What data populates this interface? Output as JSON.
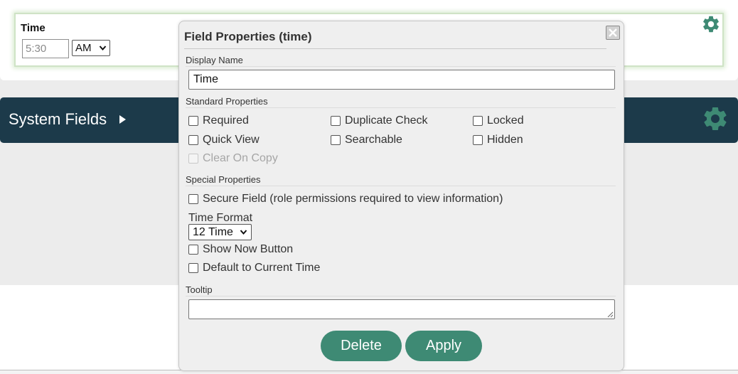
{
  "background": {
    "time_field": {
      "label": "Time",
      "value": "5:30",
      "ampm": "AM",
      "settings_icon": "gear-icon"
    },
    "system_fields": {
      "title": "System Fields",
      "expand_icon": "caret-right-icon",
      "settings_icon": "gear-icon"
    }
  },
  "dialog": {
    "title": "Field Properties (time)",
    "close_icon": "close-icon",
    "display_name": {
      "label": "Display Name",
      "value": "Time"
    },
    "standard_properties": {
      "label": "Standard Properties",
      "options": [
        {
          "label": "Required",
          "checked": false,
          "disabled": false
        },
        {
          "label": "Duplicate Check",
          "checked": false,
          "disabled": false
        },
        {
          "label": "Locked",
          "checked": false,
          "disabled": false
        },
        {
          "label": "Quick View",
          "checked": false,
          "disabled": false
        },
        {
          "label": "Searchable",
          "checked": false,
          "disabled": false
        },
        {
          "label": "Hidden",
          "checked": false,
          "disabled": false
        },
        {
          "label": "Clear On Copy",
          "checked": false,
          "disabled": true
        }
      ]
    },
    "special_properties": {
      "label": "Special Properties",
      "secure_field": {
        "label": "Secure Field (role permissions required to view information)",
        "checked": false
      },
      "time_format": {
        "label": "Time Format",
        "selected": "12 Time"
      },
      "show_now_button": {
        "label": "Show Now Button",
        "checked": false
      },
      "default_current_time": {
        "label": "Default to Current Time",
        "checked": false
      }
    },
    "tooltip": {
      "label": "Tooltip",
      "value": ""
    },
    "buttons": {
      "delete": "Delete",
      "apply": "Apply"
    }
  },
  "colors": {
    "header_bar": "#1c3a4a",
    "accent_green": "#3e8a74",
    "gear_green": "#3e8a74"
  }
}
